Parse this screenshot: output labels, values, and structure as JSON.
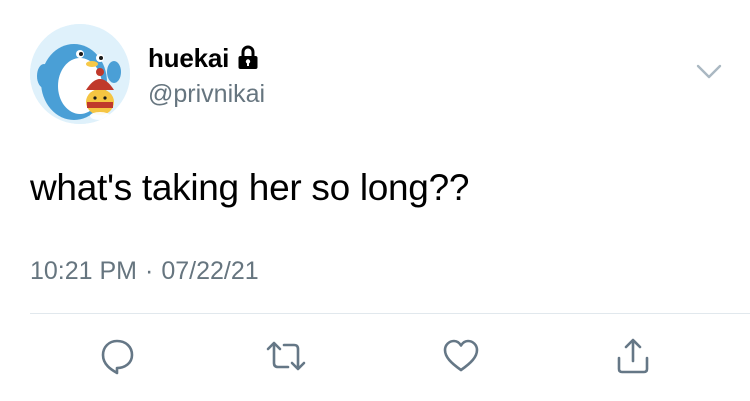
{
  "user": {
    "display_name": "huekai",
    "handle": "@privnikai",
    "protected": true
  },
  "tweet": {
    "text": "what's taking her so long??",
    "time": "10:21 PM",
    "separator": "·",
    "date": "07/22/21"
  },
  "actions": {
    "reply_icon": "reply-icon",
    "retweet_icon": "retweet-icon",
    "like_icon": "like-icon",
    "share_icon": "share-icon"
  },
  "colors": {
    "secondary_text": "#66757f",
    "icon_gray": "#657786",
    "divider": "#e1e8ed",
    "chevron": "#aab8c2"
  }
}
